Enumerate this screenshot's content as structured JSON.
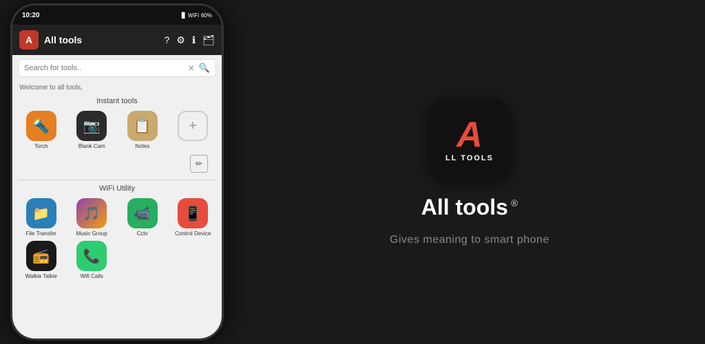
{
  "phone": {
    "time": "10:20",
    "battery": "60%",
    "header": {
      "title": "All tools",
      "logo_letter": "A"
    },
    "search": {
      "placeholder": "Search for tools.."
    },
    "welcome": "Welcome to all tools,",
    "sections": [
      {
        "title": "Instant tools",
        "tools": [
          {
            "label": "Torch",
            "icon": "🔦",
            "color_class": "icon-orange"
          },
          {
            "label": "Blank Cam",
            "icon": "📷",
            "color_class": "icon-dark"
          },
          {
            "label": "Notes",
            "icon": "📋",
            "color_class": "icon-tan"
          },
          {
            "label": "+",
            "icon": "+",
            "color_class": "icon-add"
          }
        ]
      },
      {
        "title": "WiFi Utility",
        "tools": [
          {
            "label": "File Transfer",
            "icon": "📁",
            "color_class": "icon-blue"
          },
          {
            "label": "Music Group",
            "icon": "🎵",
            "color_class": "icon-purple-multi"
          },
          {
            "label": "Cctv",
            "icon": "📹",
            "color_class": "icon-green-dark"
          },
          {
            "label": "Control Device",
            "icon": "📱",
            "color_class": "icon-red"
          },
          {
            "label": "Walkie Talkie",
            "icon": "📻",
            "color_class": "icon-dark2"
          },
          {
            "label": "Wifi Calls",
            "icon": "📞",
            "color_class": "icon-green2"
          }
        ]
      }
    ]
  },
  "brand": {
    "app_name": "All tools",
    "registered_symbol": "®",
    "tagline": "Gives meaning to smart phone",
    "icon_letter": "A",
    "icon_sub": "LL TOOLS"
  },
  "header_icons": {
    "help": "?",
    "settings": "⚙",
    "info": "ℹ",
    "folder": "🗂"
  }
}
